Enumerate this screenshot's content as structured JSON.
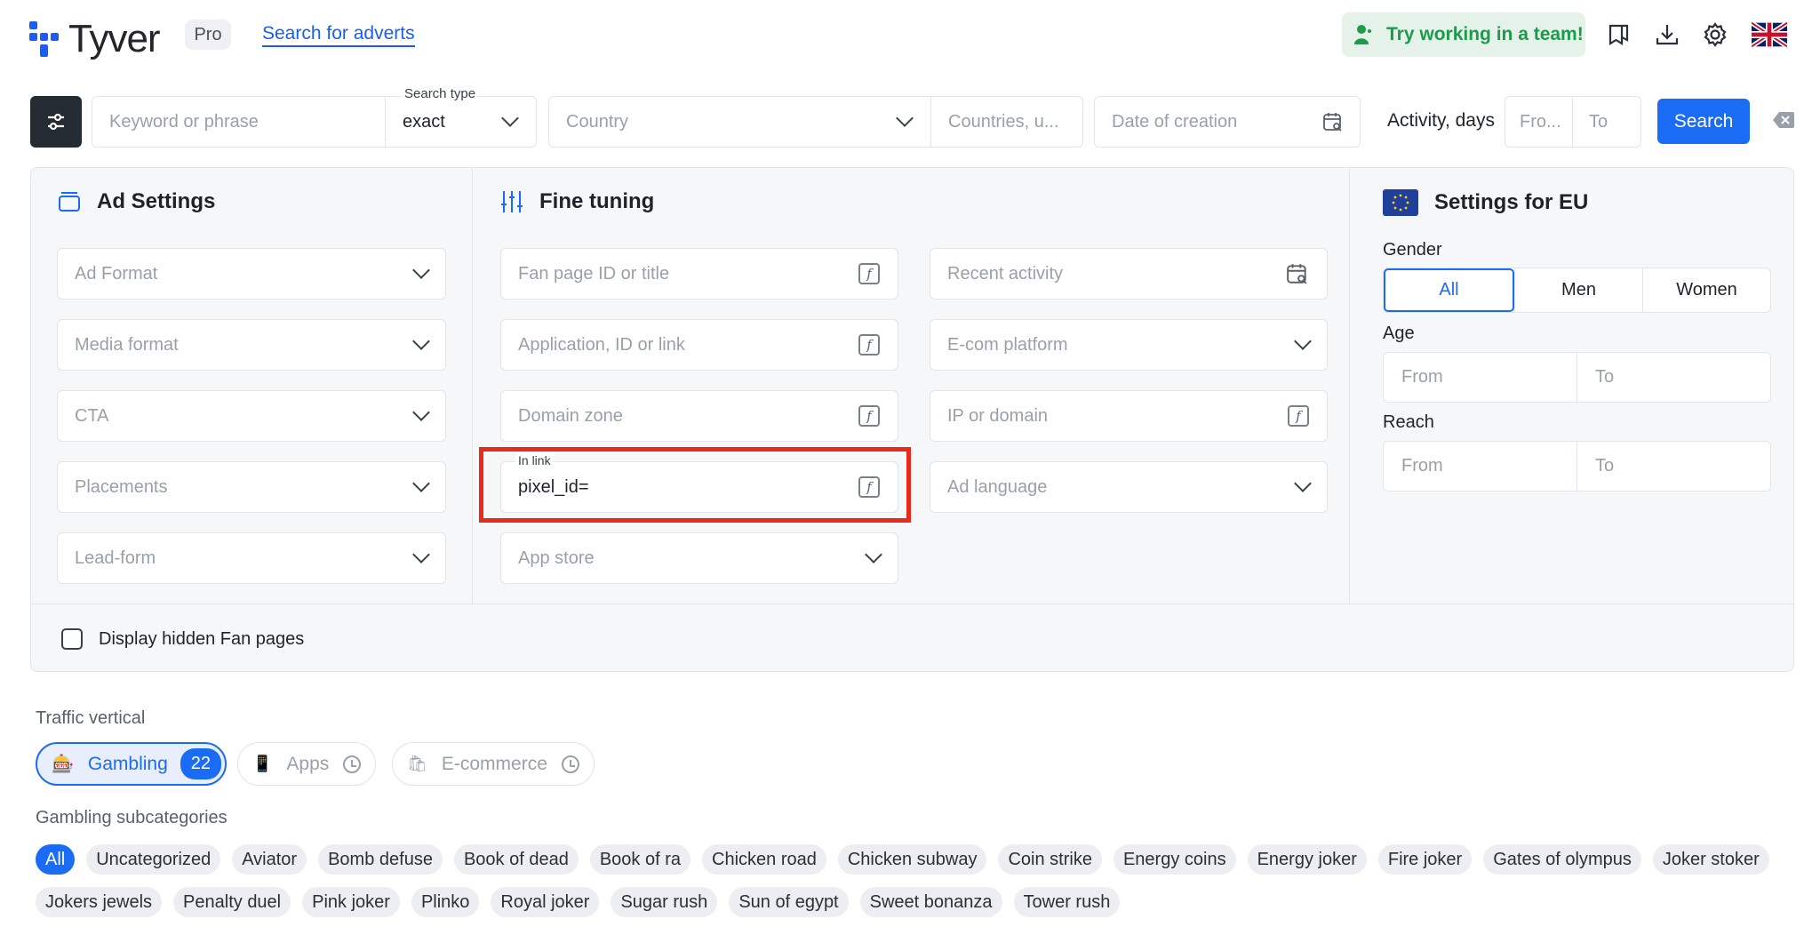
{
  "header": {
    "logo_text": "Tyver",
    "badge": "Pro",
    "search_link": "Search for adverts",
    "team_button": "Try working in a team!",
    "icons": [
      "bookmarks-icon",
      "download-icon",
      "settings-icon",
      "uk-flag-icon"
    ]
  },
  "search_bar": {
    "keyword_placeholder": "Keyword or phrase",
    "search_type_label": "Search type",
    "search_type_value": "exact",
    "country_placeholder": "Country",
    "countries_placeholder": "Countries, u...",
    "date_placeholder": "Date of creation",
    "activity_label": "Activity, days",
    "from_placeholder": "Fro...",
    "to_placeholder": "To",
    "search_button": "Search"
  },
  "ad_settings": {
    "title": "Ad Settings",
    "fields": [
      "Ad Format",
      "Media format",
      "CTA",
      "Placements",
      "Lead-form"
    ]
  },
  "fine_tuning": {
    "title": "Fine tuning",
    "left_fields": [
      "Fan page ID or title",
      "Application, ID or link",
      "Domain zone"
    ],
    "in_link_label": "In link",
    "in_link_value": "pixel_id=",
    "app_store": "App store",
    "right_fields": [
      "Recent activity",
      "E-com platform",
      "IP or domain",
      "Ad language"
    ]
  },
  "eu_settings": {
    "title": "Settings for EU",
    "gender_label": "Gender",
    "gender_options": [
      "All",
      "Men",
      "Women"
    ],
    "gender_selected": "All",
    "age_label": "Age",
    "reach_label": "Reach",
    "from": "From",
    "to": "To"
  },
  "hidden_fan_pages": "Display hidden Fan pages",
  "traffic": {
    "label": "Traffic vertical",
    "verticals": [
      {
        "label": "Gambling",
        "count": "22",
        "active": true
      },
      {
        "label": "Apps",
        "active": false
      },
      {
        "label": "E-commerce",
        "active": false
      }
    ]
  },
  "subcategories": {
    "label": "Gambling subcategories",
    "items": [
      "All",
      "Uncategorized",
      "Aviator",
      "Bomb defuse",
      "Book of dead",
      "Book of ra",
      "Chicken road",
      "Chicken subway",
      "Coin strike",
      "Energy coins",
      "Energy joker",
      "Fire joker",
      "Gates of olympus",
      "Joker stoker",
      "Jokers jewels",
      "Penalty duel",
      "Pink joker",
      "Plinko",
      "Royal joker",
      "Sugar rush",
      "Sun of egypt",
      "Sweet bonanza",
      "Tower rush"
    ]
  },
  "colors": {
    "accent": "#1a6cf5",
    "highlight": "#e92a1a",
    "team_green": "#1d9a4a"
  }
}
